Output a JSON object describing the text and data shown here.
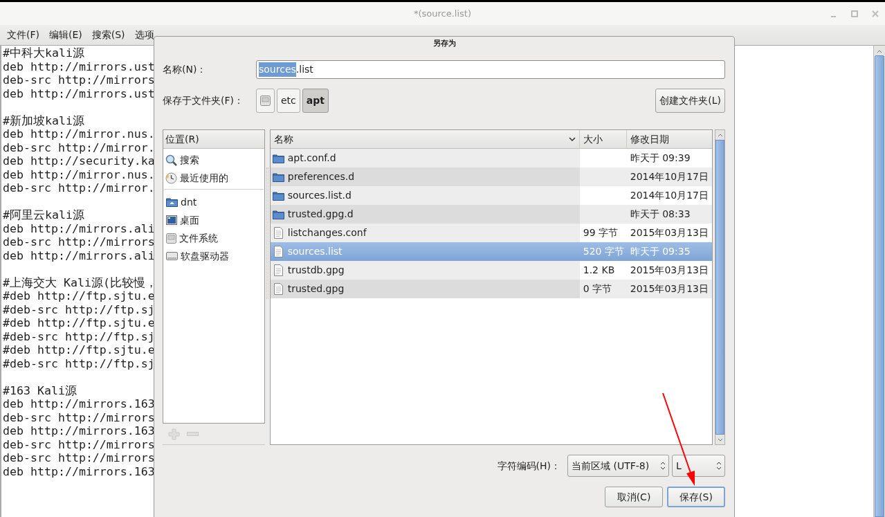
{
  "window": {
    "title": "*(source.list)"
  },
  "menu": [
    {
      "label": "文件(F)"
    },
    {
      "label": "编辑(E)"
    },
    {
      "label": "搜索(S)"
    },
    {
      "label": "选项"
    }
  ],
  "editor": {
    "blocks": [
      [
        "#中科大kali源",
        "deb http://mirrors.ust",
        "deb-src http://mirrors",
        "deb http://mirrors.ust"
      ],
      [
        "#新加坡kali源",
        "deb http://mirror.nus.",
        "deb-src http://mirror.",
        "deb http://security.ka",
        "deb http://mirror.nus.",
        "deb-src http://mirror."
      ],
      [
        "#阿里云kali源",
        "deb http://mirrors.ali",
        "deb-src http://mirrors",
        "deb http://mirrors.ali"
      ],
      [
        "#上海交大 Kali源(比较慢，",
        "#deb http://ftp.sjtu.e",
        "#deb-src http://ftp.sj",
        "#deb http://ftp.sjtu.e",
        "#deb-src http://ftp.sj",
        "#deb http://ftp.sjtu.e",
        "#deb-src http://ftp.sj"
      ],
      [
        "#163 Kali源",
        "deb http://mirrors.163",
        "deb-src http://mirrors",
        "deb http://mirrors.163",
        "deb-src http://mirrors",
        "deb-src http://mirrors",
        "deb http://mirrors.163"
      ]
    ]
  },
  "dialog": {
    "title": "另存为",
    "name_label": "名称(N)：",
    "name_field": {
      "selected_text": "sources",
      "rest_text": ".list"
    },
    "folder_label": "保存于文件夹(F)：",
    "path": [
      {
        "kind": "disk",
        "selected": false
      },
      {
        "kind": "folder",
        "label": "etc",
        "selected": false
      },
      {
        "kind": "folder",
        "label": "apt",
        "selected": true
      }
    ],
    "create_folder_button": "创建文件夹(L)",
    "places": {
      "header": "位置(R)",
      "groups": [
        [
          {
            "kind": "search",
            "label": "搜索"
          },
          {
            "kind": "recent",
            "label": "最近使用的"
          }
        ],
        [
          {
            "kind": "home",
            "label": "dnt"
          },
          {
            "kind": "desktop",
            "label": "桌面"
          },
          {
            "kind": "filesystem",
            "label": "文件系统"
          },
          {
            "kind": "floppy",
            "label": "软盘驱动器"
          }
        ]
      ]
    },
    "files": {
      "columns": [
        "名称",
        "大小",
        "修改日期"
      ],
      "rows": [
        {
          "kind": "folder",
          "name": "apt.conf.d",
          "date": "昨天于 09:39",
          "selected": false
        },
        {
          "kind": "folder",
          "name": "preferences.d",
          "date": "2014年10月17日",
          "selected": false
        },
        {
          "kind": "folder",
          "name": "sources.list.d",
          "date": "2014年10月17日",
          "selected": false
        },
        {
          "kind": "folder",
          "name": "trusted.gpg.d",
          "date": "昨天于 08:33",
          "selected": false
        },
        {
          "kind": "file",
          "name": "listchanges.conf",
          "size": "99 字节",
          "date": "2015年03月13日",
          "selected": false
        },
        {
          "kind": "file",
          "name": "sources.list",
          "size": "520 字节",
          "date": "昨天于 09:35",
          "selected": true
        },
        {
          "kind": "file",
          "name": "trustdb.gpg",
          "size": "1.2 KB",
          "date": "2015年03月13日",
          "selected": false
        },
        {
          "kind": "file",
          "name": "trusted.gpg",
          "size": "0 字节",
          "date": "2015年03月13日",
          "selected": false
        }
      ]
    },
    "encoding_label": "字符编码(H)：",
    "encoding": "当前区域 (UTF-8)",
    "line_ending": "L",
    "buttons": [
      {
        "label": "取消(C)",
        "focused": false
      },
      {
        "label": "保存(S)",
        "focused": true
      }
    ]
  }
}
